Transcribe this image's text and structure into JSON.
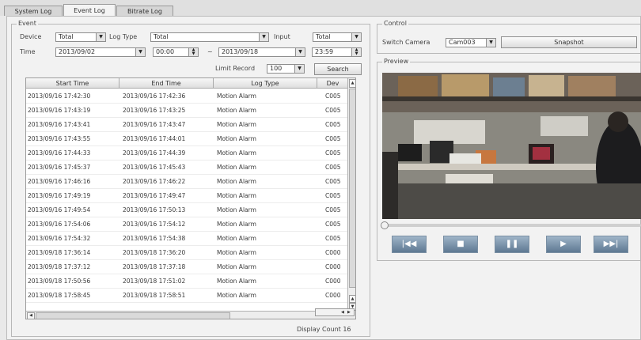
{
  "tabs": [
    {
      "label": "System Log",
      "active": false
    },
    {
      "label": "Event Log",
      "active": true
    },
    {
      "label": "Bitrate Log",
      "active": false
    }
  ],
  "event": {
    "legend": "Event",
    "device_label": "Device",
    "device_value": "Total",
    "log_type_label": "Log Type",
    "log_type_value": "Total",
    "input_label": "Input",
    "input_value": "Total",
    "time_label": "Time",
    "start_date": "2013/09/02",
    "start_time": "00:00",
    "separator": "~",
    "end_date": "2013/09/18",
    "end_time": "23:59",
    "limit_label": "Limit Record",
    "limit_value": "100",
    "search_label": "Search"
  },
  "table": {
    "headers": [
      "Start Time",
      "End Time",
      "Log Type",
      "Dev"
    ],
    "rows": [
      [
        "2013/09/16 17:42:30",
        "2013/09/16 17:42:36",
        "Motion Alarm",
        "C005"
      ],
      [
        "2013/09/16 17:43:19",
        "2013/09/16 17:43:25",
        "Motion Alarm",
        "C005"
      ],
      [
        "2013/09/16 17:43:41",
        "2013/09/16 17:43:47",
        "Motion Alarm",
        "C005"
      ],
      [
        "2013/09/16 17:43:55",
        "2013/09/16 17:44:01",
        "Motion Alarm",
        "C005"
      ],
      [
        "2013/09/16 17:44:33",
        "2013/09/16 17:44:39",
        "Motion Alarm",
        "C005"
      ],
      [
        "2013/09/16 17:45:37",
        "2013/09/16 17:45:43",
        "Motion Alarm",
        "C005"
      ],
      [
        "2013/09/16 17:46:16",
        "2013/09/16 17:46:22",
        "Motion Alarm",
        "C005"
      ],
      [
        "2013/09/16 17:49:19",
        "2013/09/16 17:49:47",
        "Motion Alarm",
        "C005"
      ],
      [
        "2013/09/16 17:49:54",
        "2013/09/16 17:50:13",
        "Motion Alarm",
        "C005"
      ],
      [
        "2013/09/16 17:54:06",
        "2013/09/16 17:54:12",
        "Motion Alarm",
        "C005"
      ],
      [
        "2013/09/16 17:54:32",
        "2013/09/16 17:54:38",
        "Motion Alarm",
        "C005"
      ],
      [
        "2013/09/18 17:36:14",
        "2013/09/18 17:36:20",
        "Motion Alarm",
        "C000"
      ],
      [
        "2013/09/18 17:37:12",
        "2013/09/18 17:37:18",
        "Motion Alarm",
        "C000"
      ],
      [
        "2013/09/18 17:50:56",
        "2013/09/18 17:51:02",
        "Motion Alarm",
        "C000"
      ],
      [
        "2013/09/18 17:58:45",
        "2013/09/18 17:58:51",
        "Motion Alarm",
        "C000"
      ]
    ]
  },
  "display_count": "Display Count 16",
  "control": {
    "legend": "Control",
    "switch_label": "Switch Camera",
    "camera_value": "Cam003",
    "snapshot_label": "Snapshot"
  },
  "preview": {
    "legend": "Preview",
    "buttons": [
      "rewind-start-icon",
      "stop-icon",
      "pause-icon",
      "play-icon",
      "fast-forward-icon"
    ]
  },
  "colors": {
    "control_button_top": "#9fb4c8",
    "control_button_bottom": "#5e7892"
  }
}
